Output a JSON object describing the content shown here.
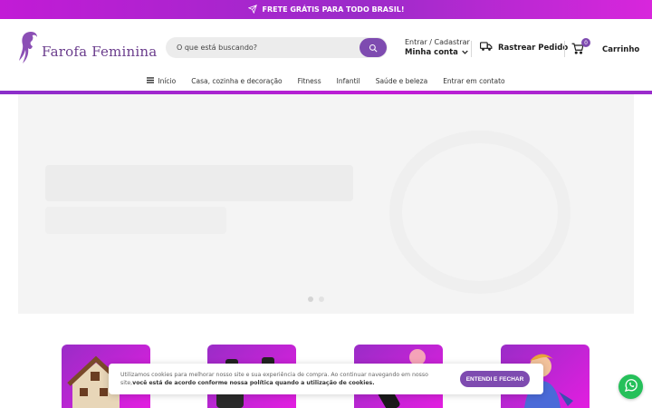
{
  "topbar": {
    "text": "FRETE GRÁTIS PARA TODO BRASIL!",
    "icon": "paper-plane-icon"
  },
  "brand": {
    "name": "Farofa Feminina",
    "color": "#6a3c8c"
  },
  "search": {
    "placeholder": "O que está buscando?",
    "value": ""
  },
  "account": {
    "line1": "Entrar / Cadastrar",
    "line2": "Minha conta"
  },
  "track": {
    "label": "Rastrear Pedido"
  },
  "cart": {
    "count": "0",
    "label": "Carrinho"
  },
  "nav": {
    "items": [
      {
        "label": "Início"
      },
      {
        "label": "Casa, cozinha e decoração"
      },
      {
        "label": "Fitness"
      },
      {
        "label": "Infantil"
      },
      {
        "label": "Saúde e beleza"
      },
      {
        "label": "Entrar em contato"
      }
    ]
  },
  "cookie": {
    "text": "Utilizamos cookies para melhorar nosso site e sua experiência de compra. Ao continuar navegando em nosso site,",
    "bold": "você está de acordo conforme nossa política quando a utilização de cookies.",
    "button": "ENTENDI E FECHAR"
  },
  "colors": {
    "accent": "#7e4bb0",
    "gradient_start": "#9b2bc9",
    "gradient_end": "#e21ee0",
    "whatsapp": "#25c05a"
  }
}
